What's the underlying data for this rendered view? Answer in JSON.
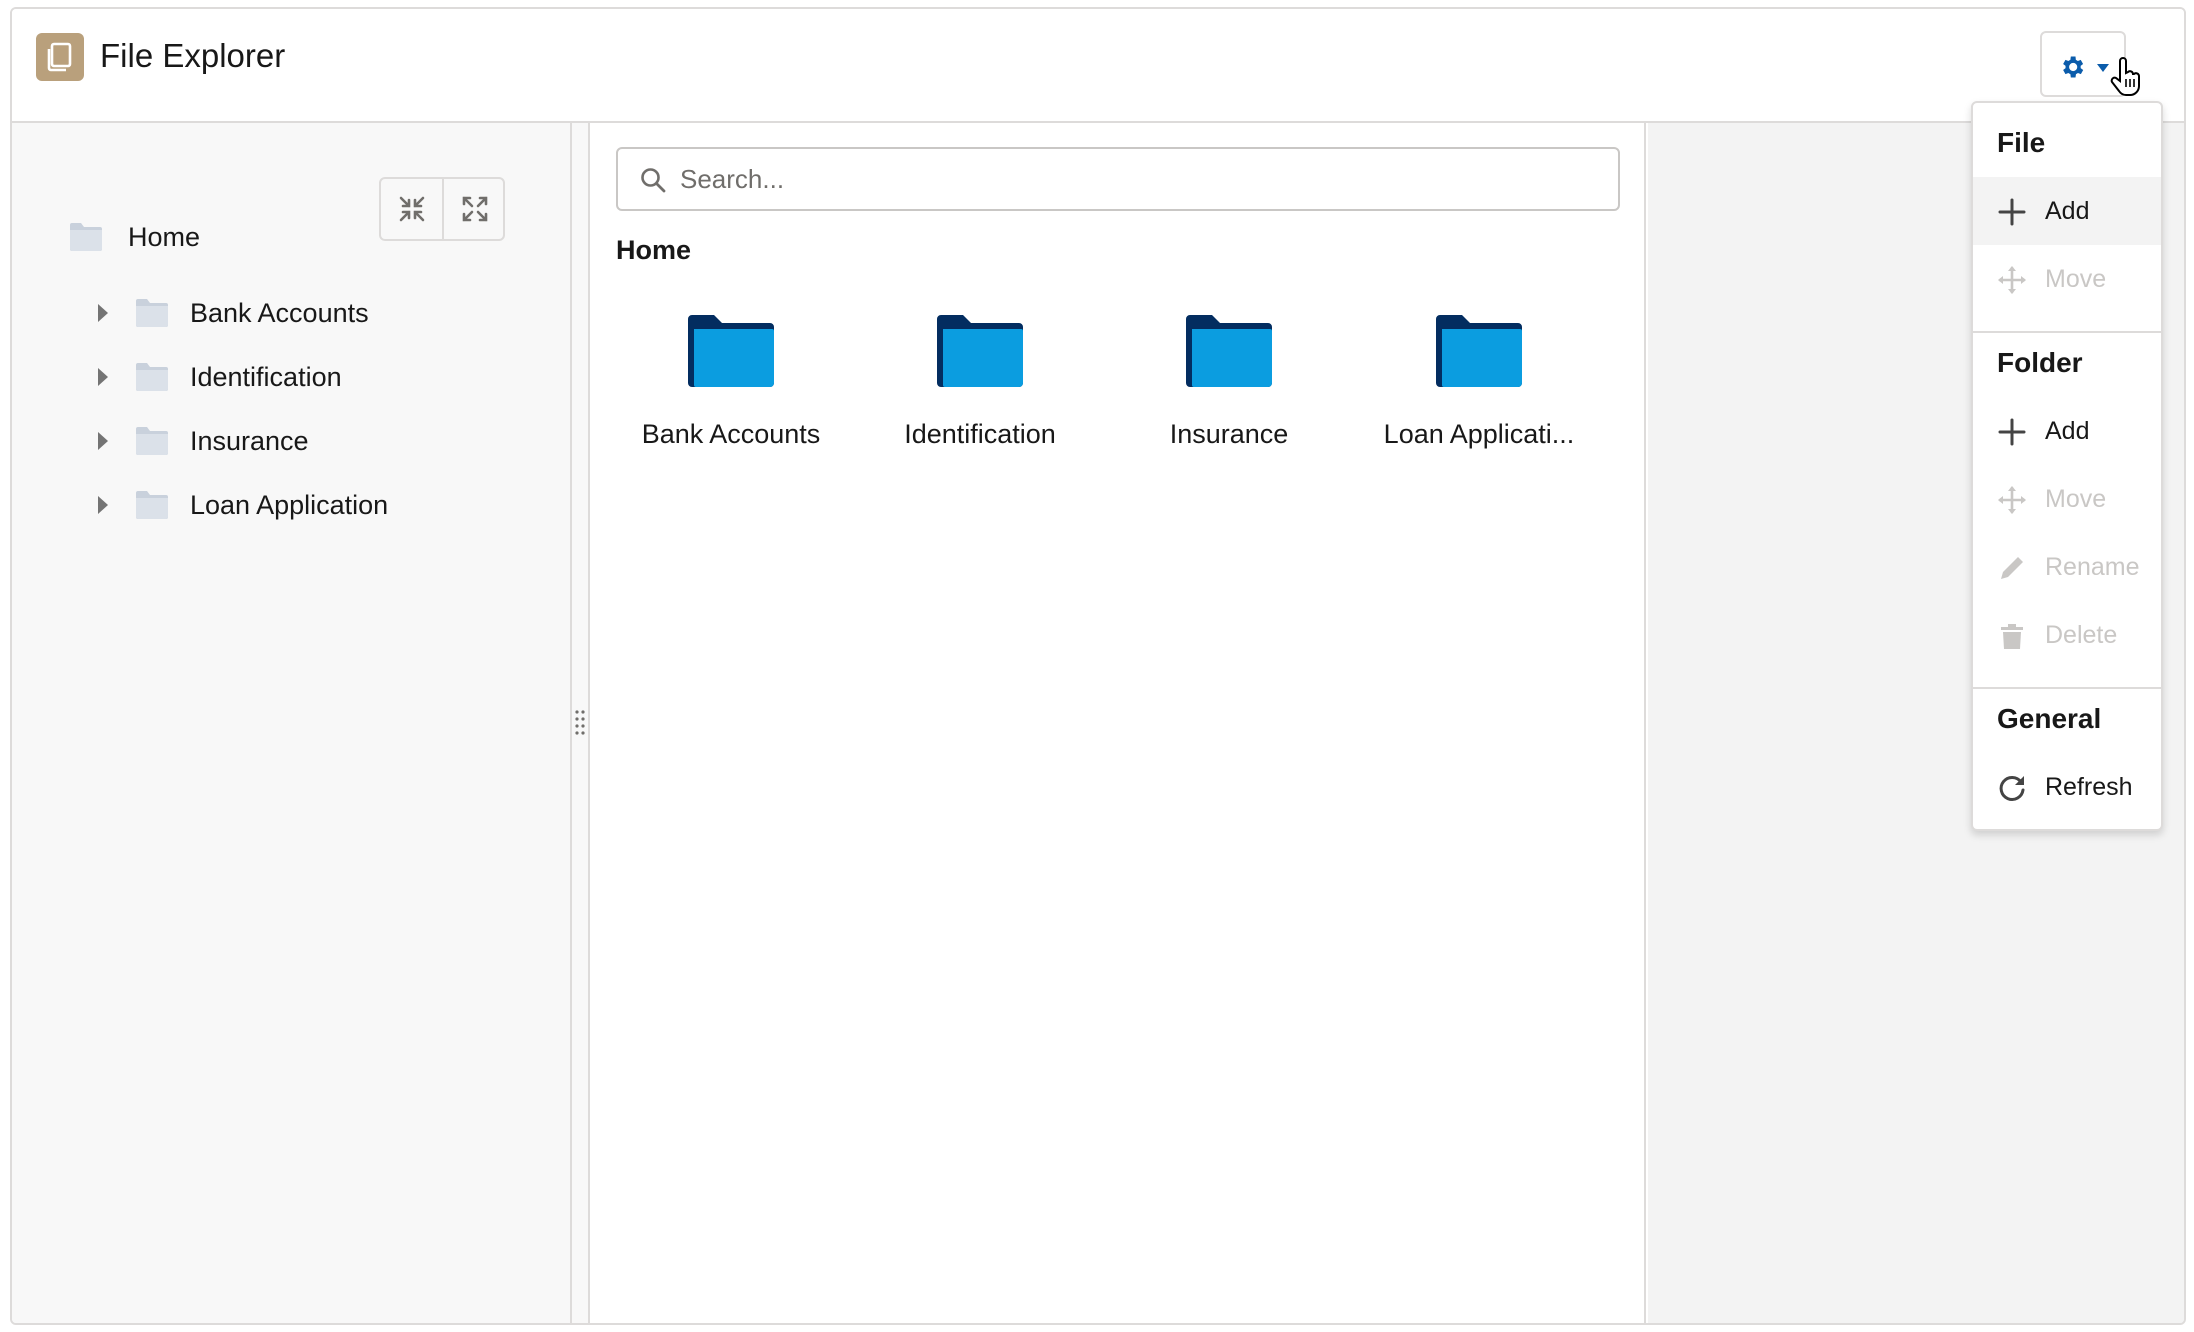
{
  "app": {
    "title": "File Explorer"
  },
  "sidebar": {
    "root": {
      "label": "Home"
    },
    "items": [
      {
        "label": "Bank Accounts"
      },
      {
        "label": "Identification"
      },
      {
        "label": "Insurance"
      },
      {
        "label": "Loan Application"
      }
    ]
  },
  "main": {
    "search_placeholder": "Search...",
    "breadcrumb": "Home",
    "folders": [
      {
        "label": "Bank Accounts"
      },
      {
        "label": "Identification"
      },
      {
        "label": "Insurance"
      },
      {
        "label": "Loan Applicati..."
      }
    ]
  },
  "menu": {
    "file": {
      "title": "File",
      "items": [
        {
          "label": "Add",
          "icon": "plus-icon",
          "disabled": false
        },
        {
          "label": "Move",
          "icon": "move-icon",
          "disabled": true
        }
      ]
    },
    "folder": {
      "title": "Folder",
      "items": [
        {
          "label": "Add",
          "icon": "plus-icon",
          "disabled": false
        },
        {
          "label": "Move",
          "icon": "move-icon",
          "disabled": true
        },
        {
          "label": "Rename",
          "icon": "pencil-icon",
          "disabled": true
        },
        {
          "label": "Delete",
          "icon": "trash-icon",
          "disabled": true
        }
      ]
    },
    "general": {
      "title": "General",
      "items": [
        {
          "label": "Refresh",
          "icon": "refresh-icon",
          "disabled": false
        }
      ]
    }
  },
  "colors": {
    "brand_icon": "#b9a07c",
    "folder_dark": "#032d60",
    "folder_light": "#0b9de0",
    "gear": "#0b5cab",
    "border": "#dddbda"
  }
}
